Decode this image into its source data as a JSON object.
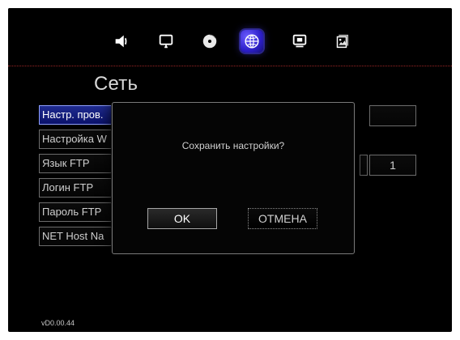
{
  "page": {
    "title": "Сеть",
    "version": "vD0.00.44"
  },
  "topbar": {
    "icons": [
      {
        "name": "speaker-icon",
        "selected": false
      },
      {
        "name": "monitor-icon",
        "selected": false
      },
      {
        "name": "disc-icon",
        "selected": false
      },
      {
        "name": "globe-icon",
        "selected": true
      },
      {
        "name": "system-icon",
        "selected": false
      },
      {
        "name": "photo-icon",
        "selected": false
      }
    ]
  },
  "menu": {
    "items": [
      {
        "label": "Настр. пров."
      },
      {
        "label": "Настройка W"
      },
      {
        "label": "Язык FTP"
      },
      {
        "label": "Логин FTP"
      },
      {
        "label": "Пароль FTP"
      },
      {
        "label": "NET Host Na"
      }
    ],
    "right_field_value": "1"
  },
  "dialog": {
    "message": "Сохранить настройки?",
    "ok_label": "OK",
    "cancel_label": "ОТМЕНА"
  },
  "colors": {
    "selected_blue": "#2d1fc9",
    "border_gray": "#6c6c6c",
    "rule_red": "#b02a2a"
  }
}
